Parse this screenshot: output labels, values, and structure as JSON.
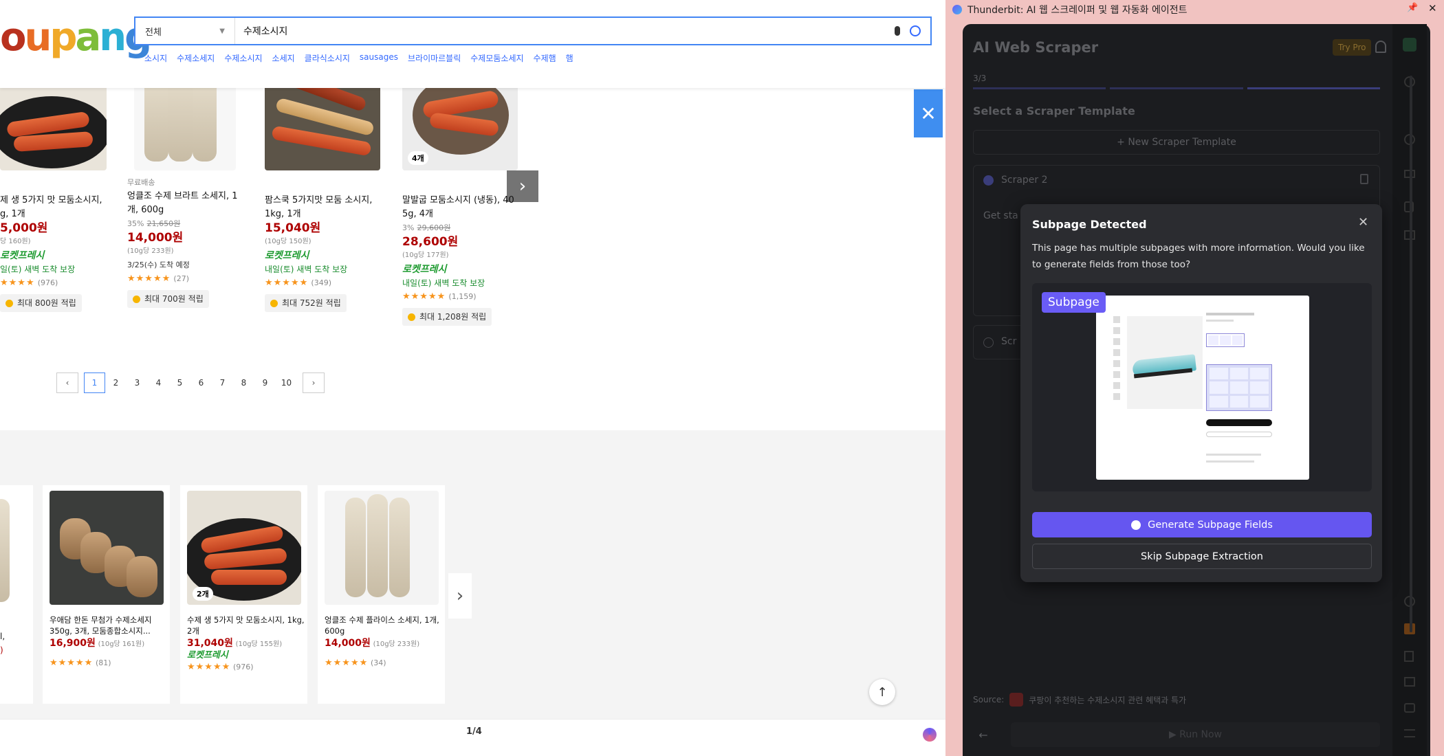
{
  "shop": {
    "logo_text": "oupang",
    "search": {
      "category": "전체",
      "query": "수제소시지"
    },
    "keywords": [
      "소시지",
      "수제소세지",
      "수제소시지",
      "소세지",
      "클라식소시지",
      "sausages",
      "브라이마르블릭",
      "수제모둠소세지",
      "수제햄",
      "햄"
    ],
    "products": [
      {
        "title_line1": "제 생 5가지 맛 모둠소시지,",
        "title_line2": "g, 1개",
        "price": "5,000원",
        "unit": "당 160원)",
        "rocket": "로켓프레시",
        "delivery": "일(토) 새벽 도착 보장",
        "stars": "★★★★",
        "reviews": "(976)",
        "points": "최대 800원 적립"
      },
      {
        "label": "무료배송",
        "title_line1": "엉클조 수제 브라트 소세지, 1",
        "title_line2": "개, 600g",
        "discount": "35%",
        "orig": "21,650원",
        "price": "14,000원",
        "unit": "(10g당 233원)",
        "delivery": "3/25(수) 도착 예정",
        "stars": "★★★★★",
        "reviews": "(27)",
        "points": "최대 700원 적립"
      },
      {
        "title_line1": "팜스쿡 5가지맛 모둠 소시지,",
        "title_line2": "1kg, 1개",
        "price": "15,040원",
        "unit": "(10g당 150원)",
        "rocket": "로켓프레시",
        "delivery": "내일(토) 새벽 도착 보장",
        "stars": "★★★★★",
        "reviews": "(349)",
        "points": "최대 752원 적립"
      },
      {
        "badge_count": "4개",
        "title_line1": "말발굽 모둠소시지 (냉동), 40",
        "title_line2": "5g, 4개",
        "discount": "3%",
        "orig": "29,600원",
        "price": "28,600원",
        "unit": "(10g당 177원)",
        "rocket": "로켓프레시",
        "delivery": "내일(토) 새벽 도착 보장",
        "stars": "★★★★★",
        "reviews": "(1,159)",
        "points": "최대 1,208원 적립"
      }
    ],
    "pagination": {
      "prev": "‹",
      "pages": [
        "1",
        "2",
        "3",
        "4",
        "5",
        "6",
        "7",
        "8",
        "9",
        "10"
      ],
      "next": "›"
    },
    "recommended": [
      {
        "line1": "l,",
        "line2": "",
        "price": ")"
      },
      {
        "line1": "우애담 한돈 무첨가 수제소세지",
        "line2": "350g, 3개, 모둠종합소시지...",
        "price": "16,900원",
        "unit": "(10g당 161원)",
        "stars": "★★★★★",
        "reviews": "(81)"
      },
      {
        "badge_count": "2개",
        "line1": "수제 생 5가지 맛 모둠소시지, 1kg,",
        "line2": "2개",
        "price": "31,040원",
        "unit": "(10g당 155원)",
        "rocket": "로켓프레시",
        "stars": "★★★★★",
        "reviews": "(976)"
      },
      {
        "line1": "엉클조 수제 플라이스 소세지, 1개,",
        "line2": "600g",
        "price": "14,000원",
        "unit": "(10g당 233원)",
        "stars": "★★★★★",
        "reviews": "(34)"
      }
    ],
    "page_indicator": "1/4"
  },
  "ext": {
    "window_title": "Thunderbit: AI 웹 스크레이퍼 및 웹 자동화 에이전트",
    "panel_title": "AI Web Scraper",
    "try_pro": "Try Pro",
    "step": "3/3",
    "section_title": "Select a Scraper Template",
    "new_template": "+ New Scraper Template",
    "scraper_name": "Scraper 2",
    "get_started": "Get sta",
    "other_scraper": "Scr",
    "source_label": "Source:",
    "source_text": "쿠팡이 추천하는 수제소시지 관련 혜택과 특가",
    "run_now": "▶ Run Now",
    "modal": {
      "title": "Subpage Detected",
      "body": "This page has multiple subpages with more information. Would you like to generate fields from those too?",
      "tag": "Subpage",
      "primary": "Generate Subpage Fields",
      "secondary": "Skip Subpage Extraction"
    }
  },
  "colors": {
    "accent": "#6556f0",
    "price_red": "#ae0000",
    "coupang_blue": "#346aff"
  }
}
